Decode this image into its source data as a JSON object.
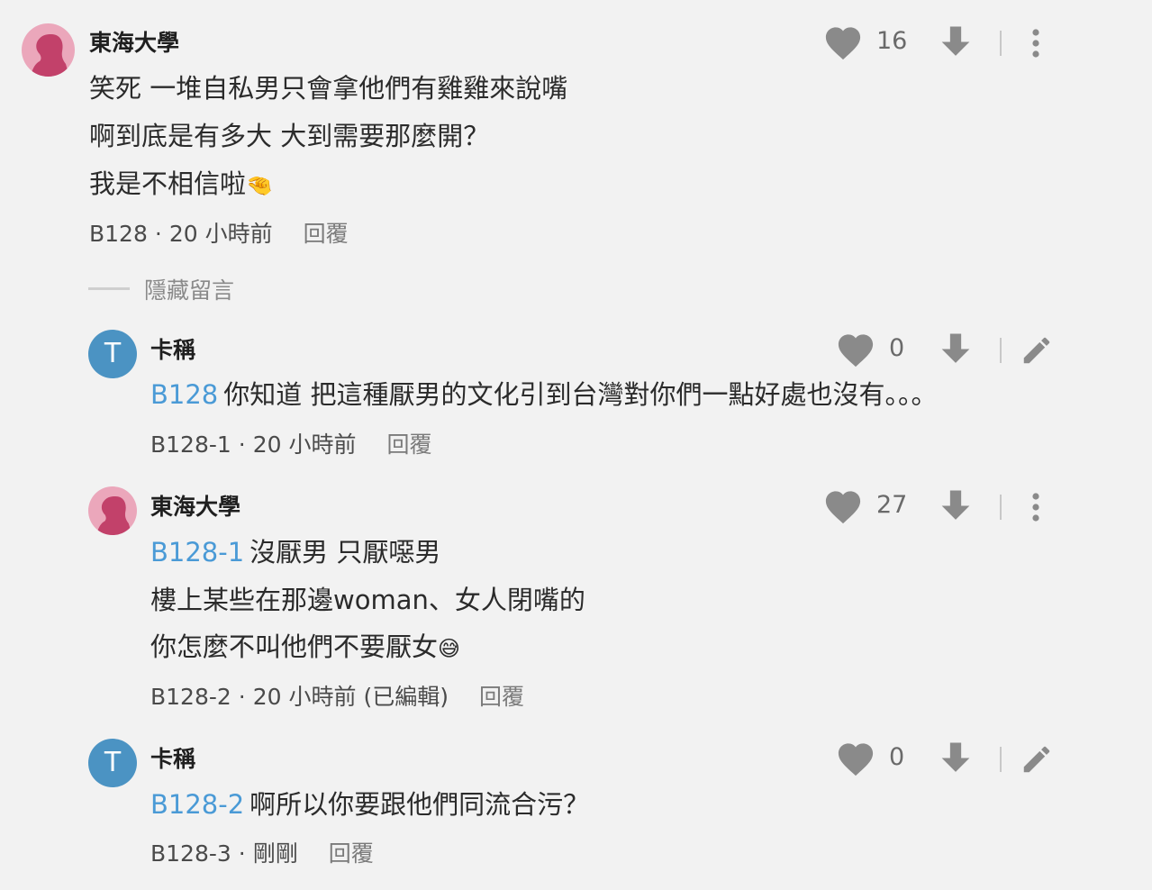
{
  "comments": [
    {
      "author": "東海大學",
      "avatar": "female-silhouette",
      "lines": [
        "笑死 一堆自私男只會拿他們有雞雞來說嘴",
        "啊到底是有多大 大到需要那麼開？",
        "我是不相信啦"
      ],
      "emoji": "🤏",
      "floor": "B128",
      "dot": "·",
      "time": "20 小時前",
      "reply": "回覆",
      "likes": "16"
    },
    {
      "author": "卡稱",
      "avatar_letter": "T",
      "tag": "B128",
      "lines": [
        "你知道 把這種厭男的文化引到台灣對你們一點好處也沒有。。。"
      ],
      "floor": "B128-1",
      "dot": "·",
      "time": "20 小時前",
      "reply": "回覆",
      "likes": "0"
    },
    {
      "author": "東海大學",
      "avatar": "female-silhouette",
      "tag": "B128-1",
      "lines": [
        "沒厭男 只厭噁男",
        "樓上某些在那邊woman、女人閉嘴的",
        "你怎麼不叫他們不要厭女"
      ],
      "emoji": "😅",
      "floor": "B128-2",
      "dot": "·",
      "time": "20 小時前 (已編輯)",
      "reply": "回覆",
      "likes": "27"
    },
    {
      "author": "卡稱",
      "avatar_letter": "T",
      "tag": "B128-2",
      "lines": [
        "啊所以你要跟他們同流合污？"
      ],
      "floor": "B128-3",
      "dot": "·",
      "time": "剛剛",
      "reply": "回覆",
      "likes": "0"
    }
  ],
  "hide_comments_label": "隱藏留言",
  "icons": {
    "like": "heart-icon",
    "dislike": "down-arrow-icon",
    "more": "more-vertical-icon",
    "edit": "pencil-icon"
  },
  "colors": {
    "background": "#f2f2f2",
    "tag_blue": "#4a9ad6",
    "avatar_pink": "#eba7bb",
    "avatar_blue": "#4b93c3",
    "icon_gray": "#8a8a8a"
  }
}
